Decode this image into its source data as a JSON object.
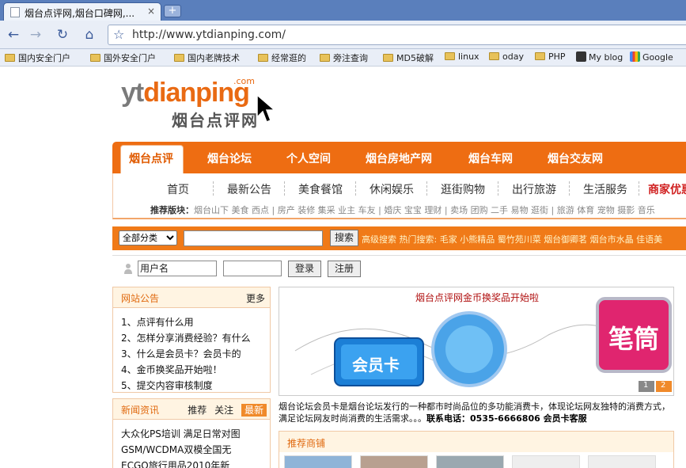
{
  "browser": {
    "tab_title": "烟台点评网,烟台口碑网,...",
    "tab_close": "×",
    "new_tab": "+",
    "url": "http://www.ytdianping.com/",
    "bookmarks": [
      {
        "label": "国内安全门户",
        "icon": "folder-icon"
      },
      {
        "label": "国外安全门户",
        "icon": "folder-icon"
      },
      {
        "label": "国内老牌技术",
        "icon": "folder-icon"
      },
      {
        "label": "经常逛的",
        "icon": "folder-icon"
      },
      {
        "label": "旁注查询",
        "icon": "folder-icon"
      },
      {
        "label": "MD5破解",
        "icon": "folder-icon"
      },
      {
        "label": "linux",
        "icon": "folder-icon"
      },
      {
        "label": "oday",
        "icon": "folder-icon"
      },
      {
        "label": "PHP",
        "icon": "folder-icon"
      },
      {
        "label": "My blog",
        "icon": "blog-icon"
      },
      {
        "label": "Google",
        "icon": "google-icon"
      }
    ]
  },
  "logo": {
    "yt": "yt",
    "dianping": "dianping",
    "com": ".com",
    "cn": "烟台点评网"
  },
  "main_nav": [
    "烟台点评",
    "烟台论坛",
    "个人空间",
    "烟台房地产网",
    "烟台车网",
    "烟台交友网"
  ],
  "sub_nav": [
    "首页",
    "最新公告",
    "美食餐馆",
    "休闲娱乐",
    "逛街购物",
    "出行旅游",
    "生活服务",
    "商家优惠"
  ],
  "recommend": {
    "label": "推荐版块：",
    "text": "烟台山下 美食 西点 | 房产 装修 集采 业主 车友 | 婚庆 宝宝 理财 | 卖场 团购 二手 易物 逛街 | 旅游 体育 宠物 摄影 音乐"
  },
  "search": {
    "category": "全部分类",
    "button": "搜索",
    "hot": "高级搜索 热门搜索: 毛家 小熊精品 蜀竹苑川菜 烟台御卿茗 烟台市水晶 佳语美"
  },
  "login": {
    "username_value": "用户名",
    "login_button": "登录",
    "register_button": "注册"
  },
  "announcement": {
    "title": "网站公告",
    "more": "更多",
    "items": [
      "1、点评有什么用",
      "2、怎样分享消费经验？有什么",
      "3、什么是会员卡？会员卡的",
      "4、金币换奖品开始啦！",
      "5、提交内容审核制度"
    ]
  },
  "news": {
    "title": "新闻资讯",
    "tabs": [
      "推荐",
      "关注",
      "最新"
    ],
    "items": [
      "大众化PS培训 满足日常对图",
      "GSM/WCDMA双模全国无",
      "ECGO旅行用品2010年新"
    ]
  },
  "banner": {
    "title": "烟台点评网金币换奖品开始啦",
    "card_label": "会员卡",
    "pink_label": "笔筒",
    "desc": "烟台论坛会员卡是烟台论坛发行的一种都市时尚品位的多功能消费卡，体现论坛网友独特的消费方式，满足论坛网友时尚消费的生活需求。。。",
    "phone": "联系电话：0535-6666806 会员卡客服",
    "pages": [
      "1",
      "2"
    ]
  },
  "shops": {
    "title": "推荐商铺"
  }
}
